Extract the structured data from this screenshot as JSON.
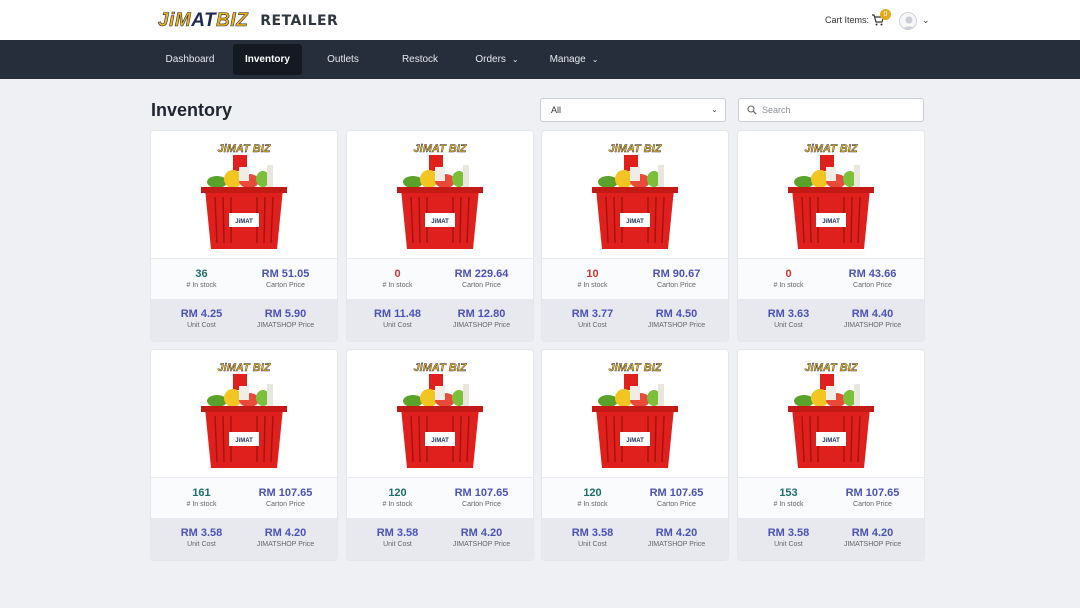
{
  "header": {
    "logo_text_a": "JiM",
    "logo_text_b": "AT",
    "logo_text_c": "BIZ",
    "logo_sub": "RETAILER",
    "cart_label": "Cart Items:",
    "cart_count": "0",
    "avatar_icon": "user-avatar-icon"
  },
  "nav": {
    "items": [
      {
        "label": "Dashboard"
      },
      {
        "label": "Inventory"
      },
      {
        "label": "Outlets"
      },
      {
        "label": "Restock"
      },
      {
        "label": "Orders"
      },
      {
        "label": "Manage"
      }
    ],
    "active": "Inventory"
  },
  "page": {
    "title": "Inventory",
    "filter_value": "All",
    "search_placeholder": "Search"
  },
  "labels": {
    "in_stock": "# In stock",
    "carton_price": "Carton Price",
    "unit_cost": "Unit Cost",
    "jimatshop_price": "JIMATSHOP Price"
  },
  "products": [
    {
      "stock": "36",
      "carton_price": "RM 51.05",
      "unit_cost": "RM 4.25",
      "shop_price": "RM 5.90",
      "stock_status": "ok"
    },
    {
      "stock": "0",
      "carton_price": "RM 229.64",
      "unit_cost": "RM 11.48",
      "shop_price": "RM 12.80",
      "stock_status": "low"
    },
    {
      "stock": "10",
      "carton_price": "RM 90.67",
      "unit_cost": "RM 3.77",
      "shop_price": "RM 4.50",
      "stock_status": "low"
    },
    {
      "stock": "0",
      "carton_price": "RM 43.66",
      "unit_cost": "RM 3.63",
      "shop_price": "RM 4.40",
      "stock_status": "low"
    },
    {
      "stock": "161",
      "carton_price": "RM 107.65",
      "unit_cost": "RM 3.58",
      "shop_price": "RM 4.20",
      "stock_status": "ok"
    },
    {
      "stock": "120",
      "carton_price": "RM 107.65",
      "unit_cost": "RM 3.58",
      "shop_price": "RM 4.20",
      "stock_status": "ok"
    },
    {
      "stock": "120",
      "carton_price": "RM 107.65",
      "unit_cost": "RM 3.58",
      "shop_price": "RM 4.20",
      "stock_status": "ok"
    },
    {
      "stock": "153",
      "carton_price": "RM 107.65",
      "unit_cost": "RM 3.58",
      "shop_price": "RM 4.20",
      "stock_status": "ok"
    }
  ],
  "colors": {
    "nav_bg": "#262d3b",
    "stock_ok": "#1c6f6d",
    "stock_low": "#d8342f",
    "price": "#4a52b8",
    "logo_yellow": "#f2b415",
    "logo_navy": "#1d2a52",
    "basket_red": "#e0201c"
  }
}
